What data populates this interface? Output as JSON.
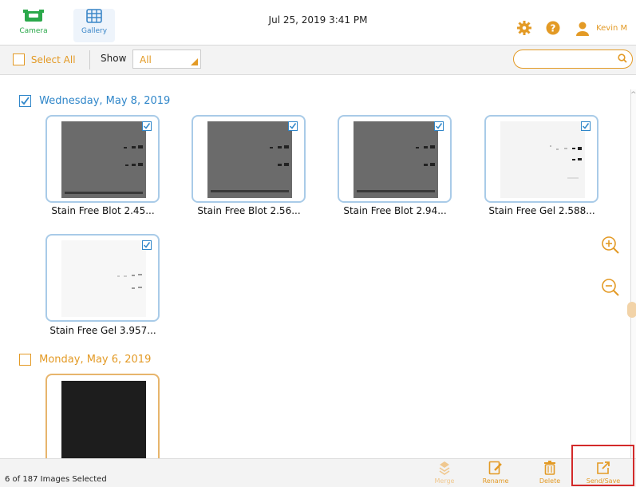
{
  "header": {
    "nav": [
      {
        "label": "Camera",
        "icon": "camera-icon"
      },
      {
        "label": "Gallery",
        "icon": "gallery-icon"
      }
    ],
    "datetime": "Jul 25, 2019  3:41 PM",
    "user": "Kevin M"
  },
  "toolbar": {
    "select_all": "Select All",
    "show_label": "Show",
    "show_value": "All",
    "search_placeholder": ""
  },
  "groups": [
    {
      "date": "Wednesday, May 8, 2019",
      "items": [
        {
          "caption": "Stain Free Blot 2.45..."
        },
        {
          "caption": "Stain Free Blot 2.56..."
        },
        {
          "caption": "Stain Free Blot 2.94..."
        },
        {
          "caption": "Stain Free Gel 2.588..."
        },
        {
          "caption": "Stain Free Gel 3.957..."
        }
      ]
    },
    {
      "date": "Monday, May 6, 2019",
      "items": [
        {
          "caption": ""
        }
      ]
    }
  ],
  "footer": {
    "status": "6 of 187 Images Selected",
    "actions": [
      {
        "label": "Merge"
      },
      {
        "label": "Rename"
      },
      {
        "label": "Delete"
      },
      {
        "label": "Send/Save"
      }
    ]
  },
  "colors": {
    "accent": "#E39A25",
    "selection": "#2F86C9",
    "highlight": "#D32A2A"
  }
}
